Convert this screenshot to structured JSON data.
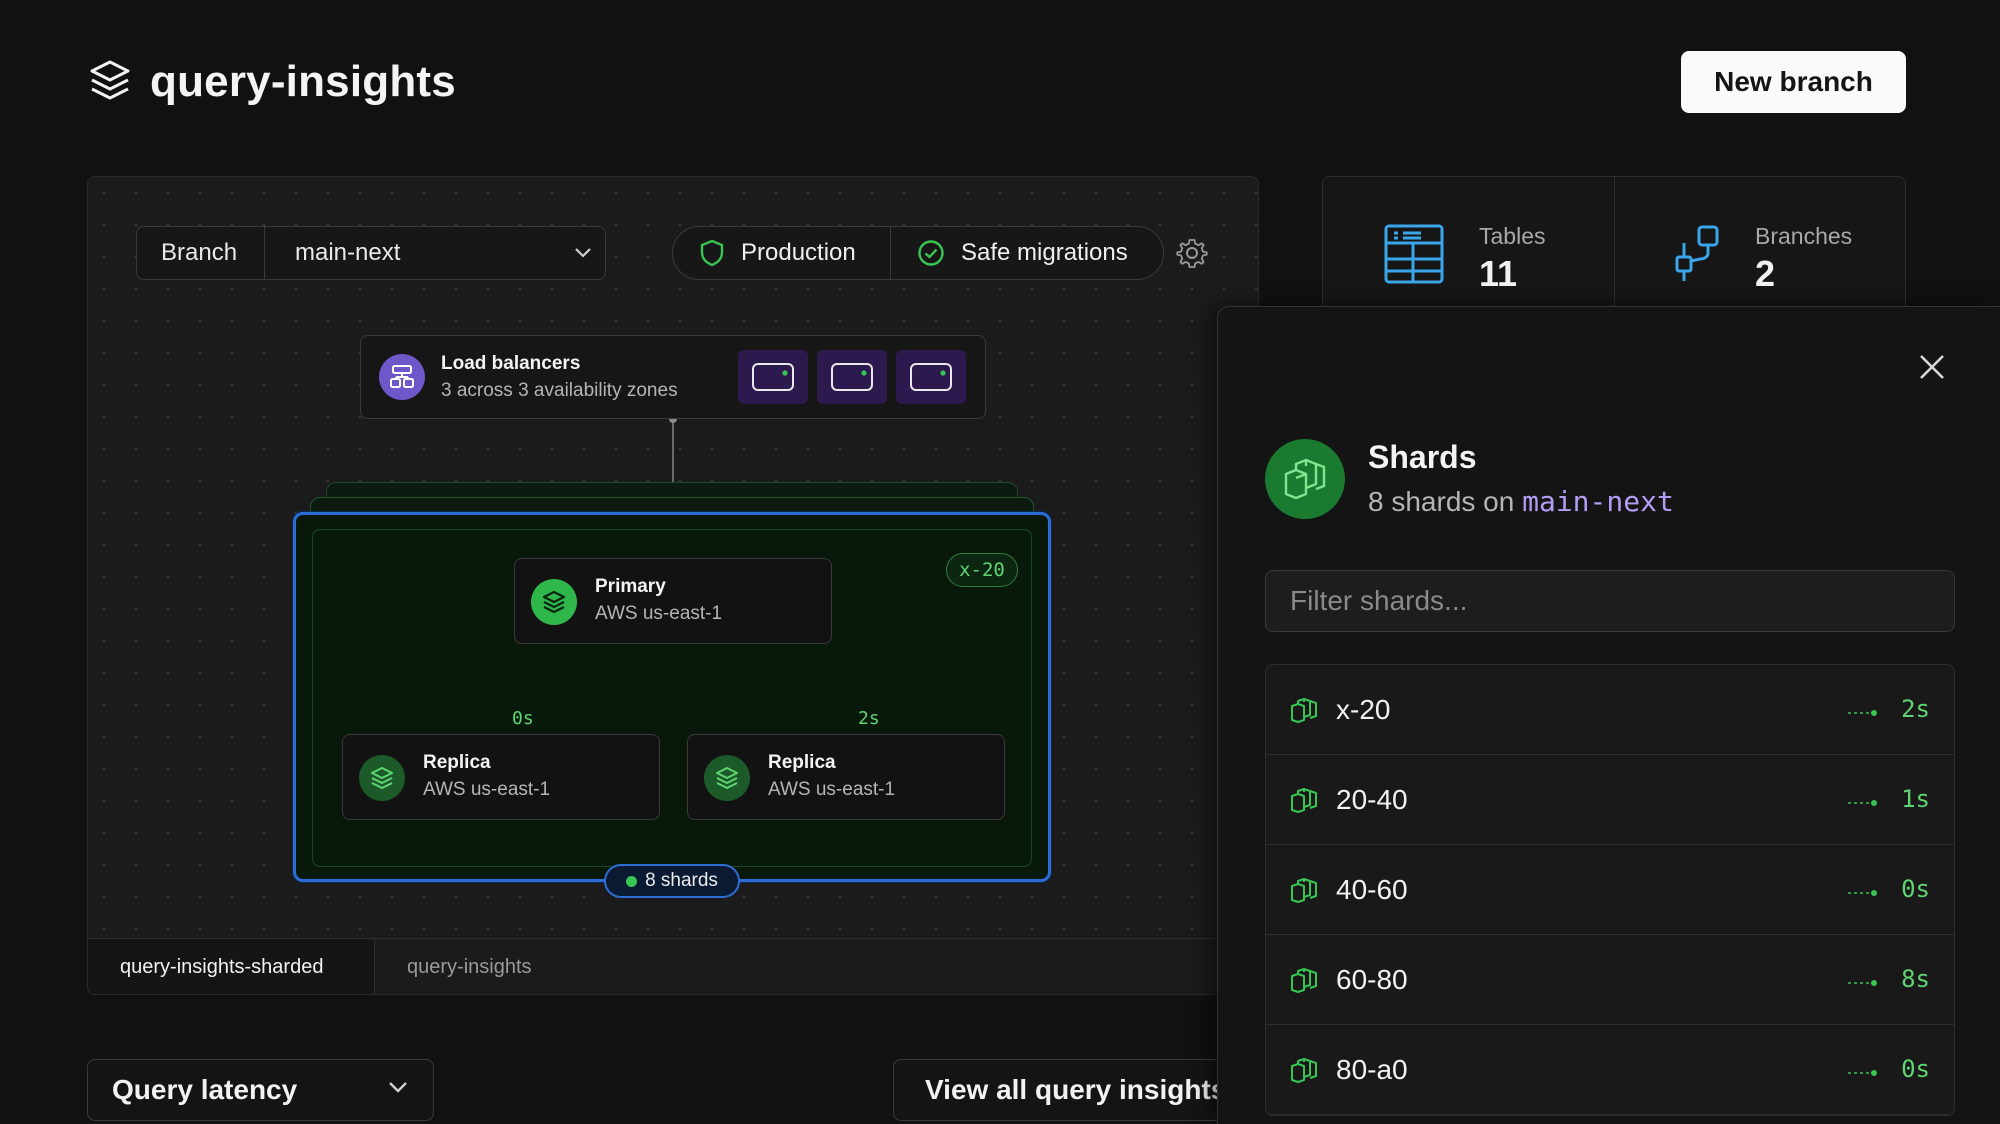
{
  "header": {
    "app_title": "query-insights",
    "new_branch_label": "New branch"
  },
  "toolbar": {
    "branch_label": "Branch",
    "branch_value": "main-next",
    "production_label": "Production",
    "safe_migrations_label": "Safe migrations"
  },
  "topology": {
    "load_balancers": {
      "title": "Load balancers",
      "subtitle": "3 across 3 availability zones",
      "instance_count": 3
    },
    "cluster_badge": "x-20",
    "primary": {
      "title": "Primary",
      "region": "AWS us-east-1"
    },
    "replicas": [
      {
        "title": "Replica",
        "region": "AWS us-east-1",
        "lag": "0s"
      },
      {
        "title": "Replica",
        "region": "AWS us-east-1",
        "lag": "2s"
      }
    ],
    "shards_badge": "8 shards"
  },
  "db_tabs": [
    {
      "label": "query-insights-sharded",
      "active": true
    },
    {
      "label": "query-insights",
      "active": false
    }
  ],
  "stats": {
    "tables_label": "Tables",
    "tables_value": "11",
    "branches_label": "Branches",
    "branches_value": "2"
  },
  "bottom": {
    "metric_select": "Query latency",
    "view_all_label": "View all query insights"
  },
  "drawer": {
    "title": "Shards",
    "subtitle_prefix": "8 shards on",
    "subtitle_branch": "main-next",
    "filter_placeholder": "Filter shards...",
    "shards": [
      {
        "name": "x-20",
        "lag": "2s"
      },
      {
        "name": "20-40",
        "lag": "1s"
      },
      {
        "name": "40-60",
        "lag": "0s"
      },
      {
        "name": "60-80",
        "lag": "8s"
      },
      {
        "name": "80-a0",
        "lag": "0s"
      }
    ]
  },
  "colors": {
    "background": "#111111",
    "accent_green": "#38c553",
    "accent_blue": "#2e6dd6",
    "accent_purple": "#6e57c8",
    "branch_highlight": "#b39cf4"
  }
}
